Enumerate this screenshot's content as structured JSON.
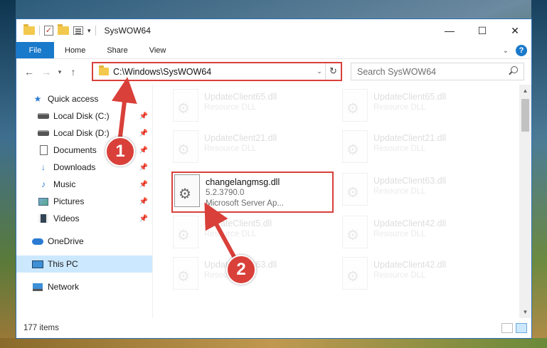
{
  "window": {
    "title": "SysWOW64",
    "controls": {
      "minimize": "—",
      "maximize": "☐",
      "close": "✕"
    }
  },
  "ribbon": {
    "tabs": [
      {
        "label": "File"
      },
      {
        "label": "Home"
      },
      {
        "label": "Share"
      },
      {
        "label": "View"
      }
    ],
    "help": "?"
  },
  "nav": {
    "back": "←",
    "forward": "→",
    "recent": "▾",
    "up": "↑",
    "address": "C:\\Windows\\SysWOW64",
    "refresh": "↻",
    "search_placeholder": "Search SysWOW64"
  },
  "sidebar": {
    "items": [
      {
        "label": "Quick access",
        "icon": "star-icon"
      },
      {
        "label": "Local Disk (C:)",
        "icon": "disk-icon",
        "pinned": true
      },
      {
        "label": "Local Disk (D:)",
        "icon": "disk-icon",
        "pinned": true
      },
      {
        "label": "Documents",
        "icon": "document-icon",
        "pinned": true
      },
      {
        "label": "Downloads",
        "icon": "download-icon",
        "pinned": true
      },
      {
        "label": "Music",
        "icon": "music-icon",
        "pinned": true
      },
      {
        "label": "Pictures",
        "icon": "pictures-icon",
        "pinned": true
      },
      {
        "label": "Videos",
        "icon": "videos-icon",
        "pinned": true
      },
      {
        "label": "OneDrive",
        "icon": "cloud-icon"
      },
      {
        "label": "This PC",
        "icon": "computer-icon",
        "selected": true
      },
      {
        "label": "Network",
        "icon": "network-icon"
      }
    ]
  },
  "files": {
    "items": [
      {
        "name": "UpdateClient65.dll",
        "meta1": "Resource DLL"
      },
      {
        "name": "UpdateClient65.dll",
        "meta1": "Resource DLL"
      },
      {
        "name": "UpdateClient21.dll",
        "meta1": "Resource DLL"
      },
      {
        "name": "UpdateClient21.dll",
        "meta1": "Resource DLL"
      },
      {
        "name": "changelangmsg.dll",
        "meta1": "5.2.3790.0",
        "meta2": "Microsoft Server Ap..."
      },
      {
        "name": "UpdateClient63.dll",
        "meta1": "Resource DLL"
      },
      {
        "name": "UpdateClient5.dll",
        "meta1": "Resource DLL"
      },
      {
        "name": "UpdateClient42.dll",
        "meta1": "Resource DLL"
      },
      {
        "name": "UpdateClient63.dll",
        "meta1": "Resource DLL"
      },
      {
        "name": "UpdateClient42.dll",
        "meta1": "Resource DLL"
      }
    ]
  },
  "status": {
    "count": "177 items"
  },
  "annotations": {
    "marker1": "1",
    "marker2": "2"
  },
  "colors": {
    "accent": "#1979ca",
    "highlight": "#d9403a",
    "selected": "#cce8ff"
  }
}
